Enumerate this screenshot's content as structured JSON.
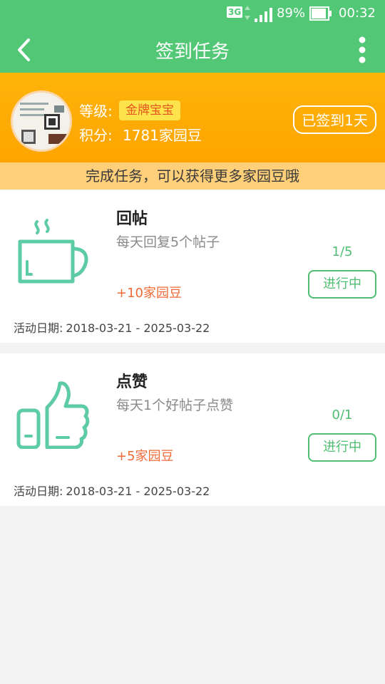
{
  "status_bar": {
    "network": "3G",
    "battery": "89%",
    "time": "00:32"
  },
  "app_bar": {
    "title": "签到任务",
    "back_icon": "chevron-left-icon",
    "more_icon": "more-vertical-icon"
  },
  "profile": {
    "level_label": "等级:",
    "level_value": "金牌宝宝",
    "points_label": "积分:",
    "points_value": "1781家园豆",
    "signed_label": "已签到1天"
  },
  "hint": "完成任务，可以获得更多家园豆哦",
  "tasks": [
    {
      "icon": "coffee-cup-icon",
      "name": "回帖",
      "desc": "每天回复5个帖子",
      "reward": "+10家园豆",
      "progress": "1/5",
      "status": "进行中",
      "date_label": "活动日期:",
      "date_value": "2018-03-21 - 2025-03-22"
    },
    {
      "icon": "thumbs-up-icon",
      "name": "点赞",
      "desc": "每天1个好帖子点赞",
      "reward": "+5家园豆",
      "progress": "0/1",
      "status": "进行中",
      "date_label": "活动日期:",
      "date_value": "2018-03-21 - 2025-03-22"
    }
  ],
  "colors": {
    "primary_green": "#52c776",
    "orange": "#fea400",
    "reward_orange": "#f06a36"
  }
}
